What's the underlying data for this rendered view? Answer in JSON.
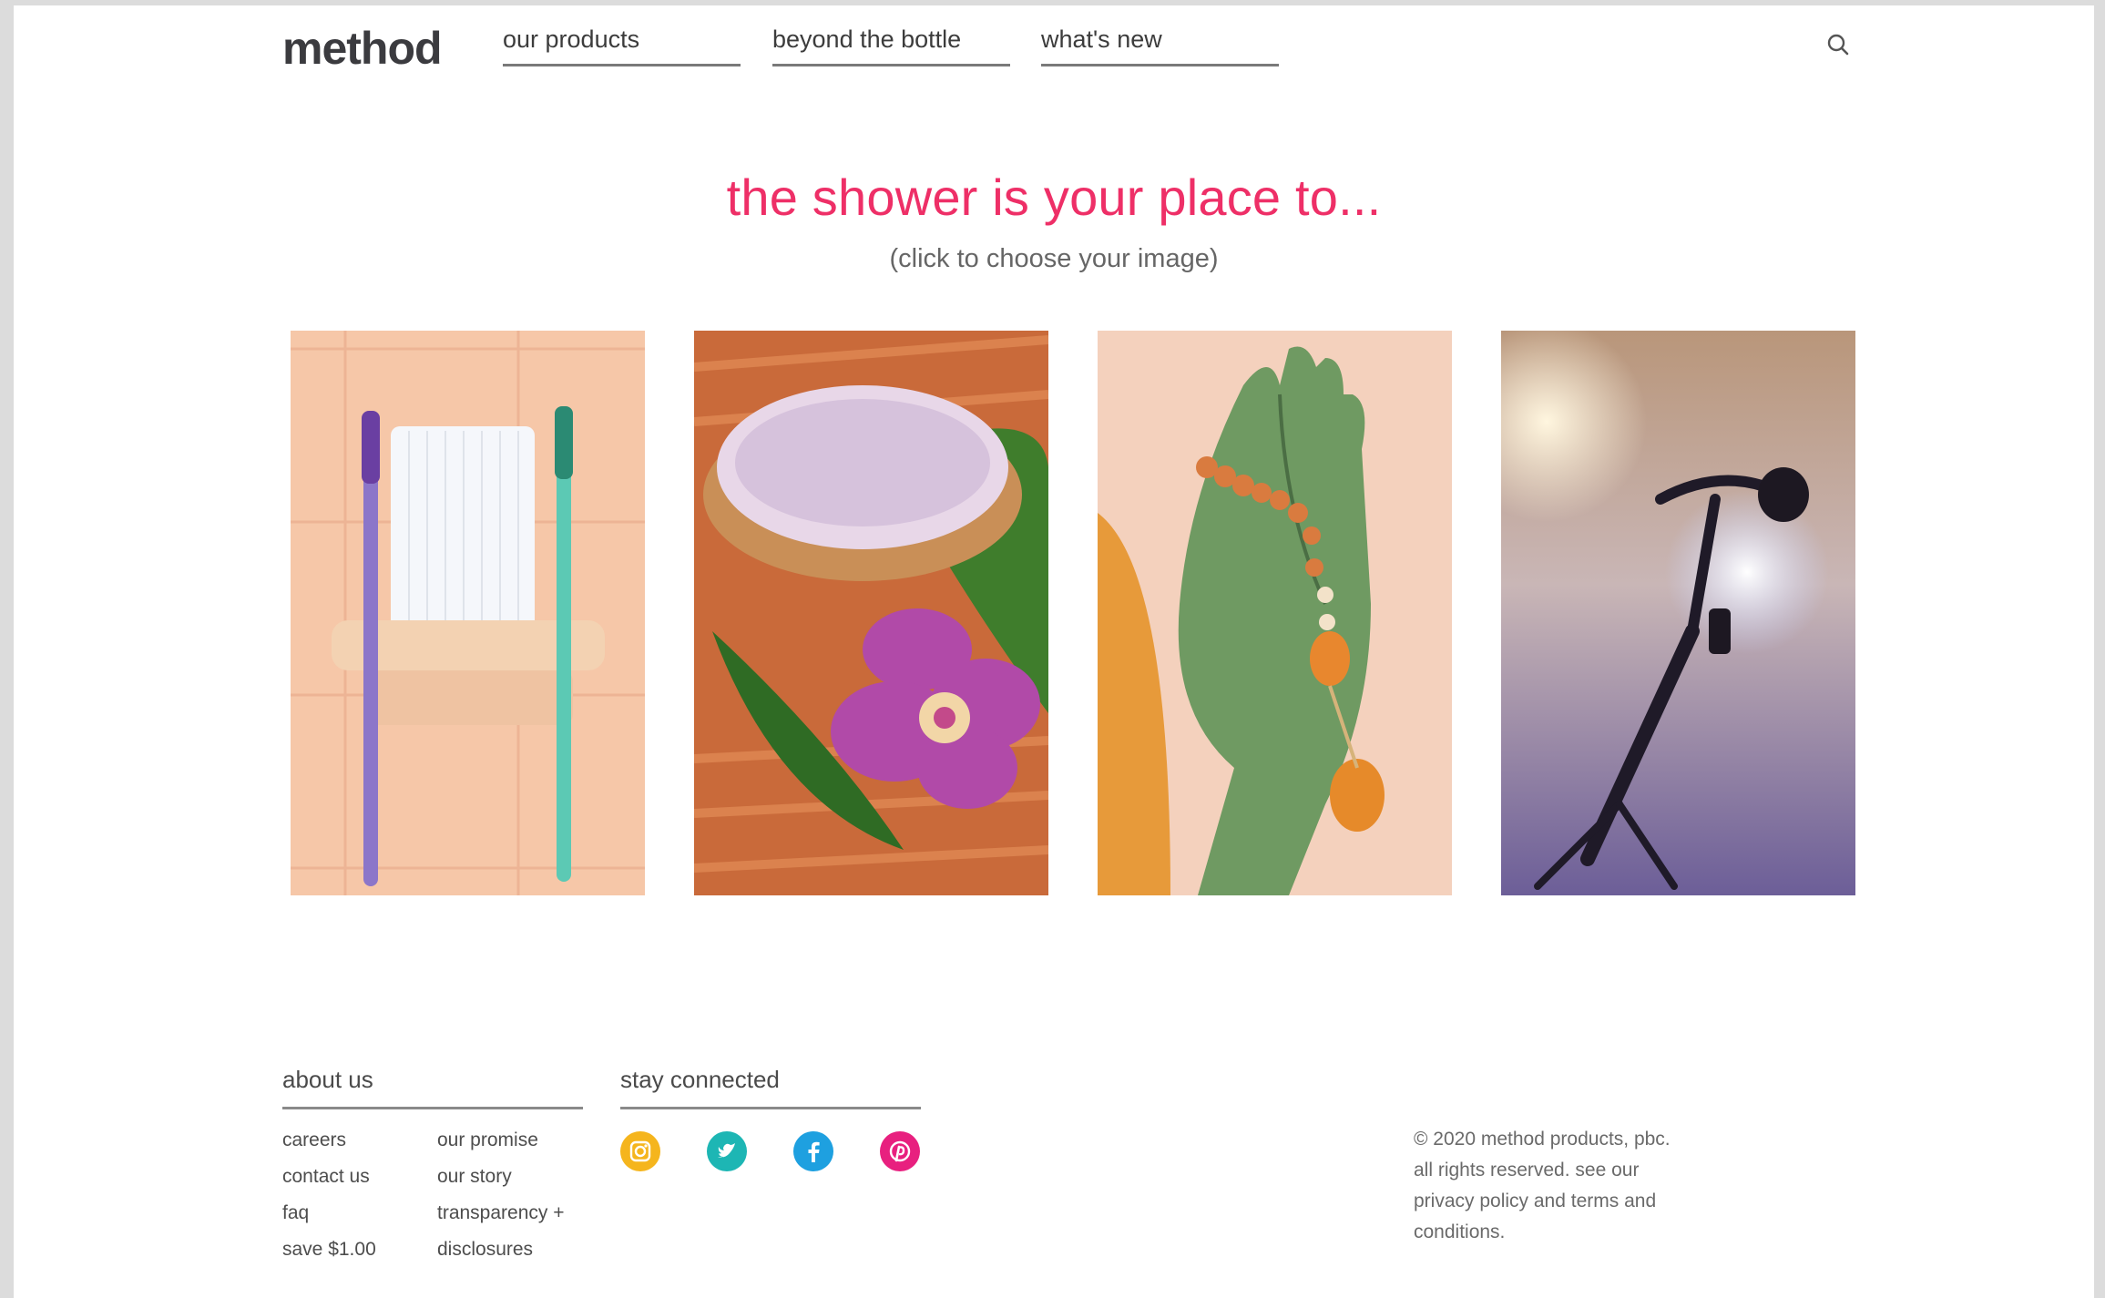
{
  "header": {
    "logo": "method",
    "nav": [
      {
        "label": "our products"
      },
      {
        "label": "beyond the bottle"
      },
      {
        "label": "what's new"
      }
    ],
    "search_icon": "search-icon"
  },
  "hero": {
    "title": "the shower is your place to...",
    "subtitle": "(click to choose your image)"
  },
  "tiles": [
    {
      "icon": "toothbrush-holder-image"
    },
    {
      "icon": "bath-salt-orchid-image"
    },
    {
      "icon": "praying-hand-statue-image"
    },
    {
      "icon": "microphone-stage-image"
    }
  ],
  "footer": {
    "about_heading": "about us",
    "about_col1": [
      "careers",
      "contact us",
      "faq",
      "save $1.00"
    ],
    "about_col2": [
      "our promise",
      "our story",
      "transparency +",
      "disclosures"
    ],
    "stay_heading": "stay connected",
    "social": [
      {
        "icon": "instagram-icon",
        "color": "#f5b51d"
      },
      {
        "icon": "twitter-icon",
        "color": "#1db6b4"
      },
      {
        "icon": "facebook-icon",
        "color": "#1ea0e0"
      },
      {
        "icon": "pinterest-icon",
        "color": "#e8207f"
      }
    ],
    "copyright_lines": [
      "© 2020 method products, pbc.",
      "all rights reserved. see our",
      "privacy policy and terms and",
      "conditions."
    ]
  },
  "colors": {
    "accent": "#ee2f67",
    "text": "#3c3c3c"
  }
}
